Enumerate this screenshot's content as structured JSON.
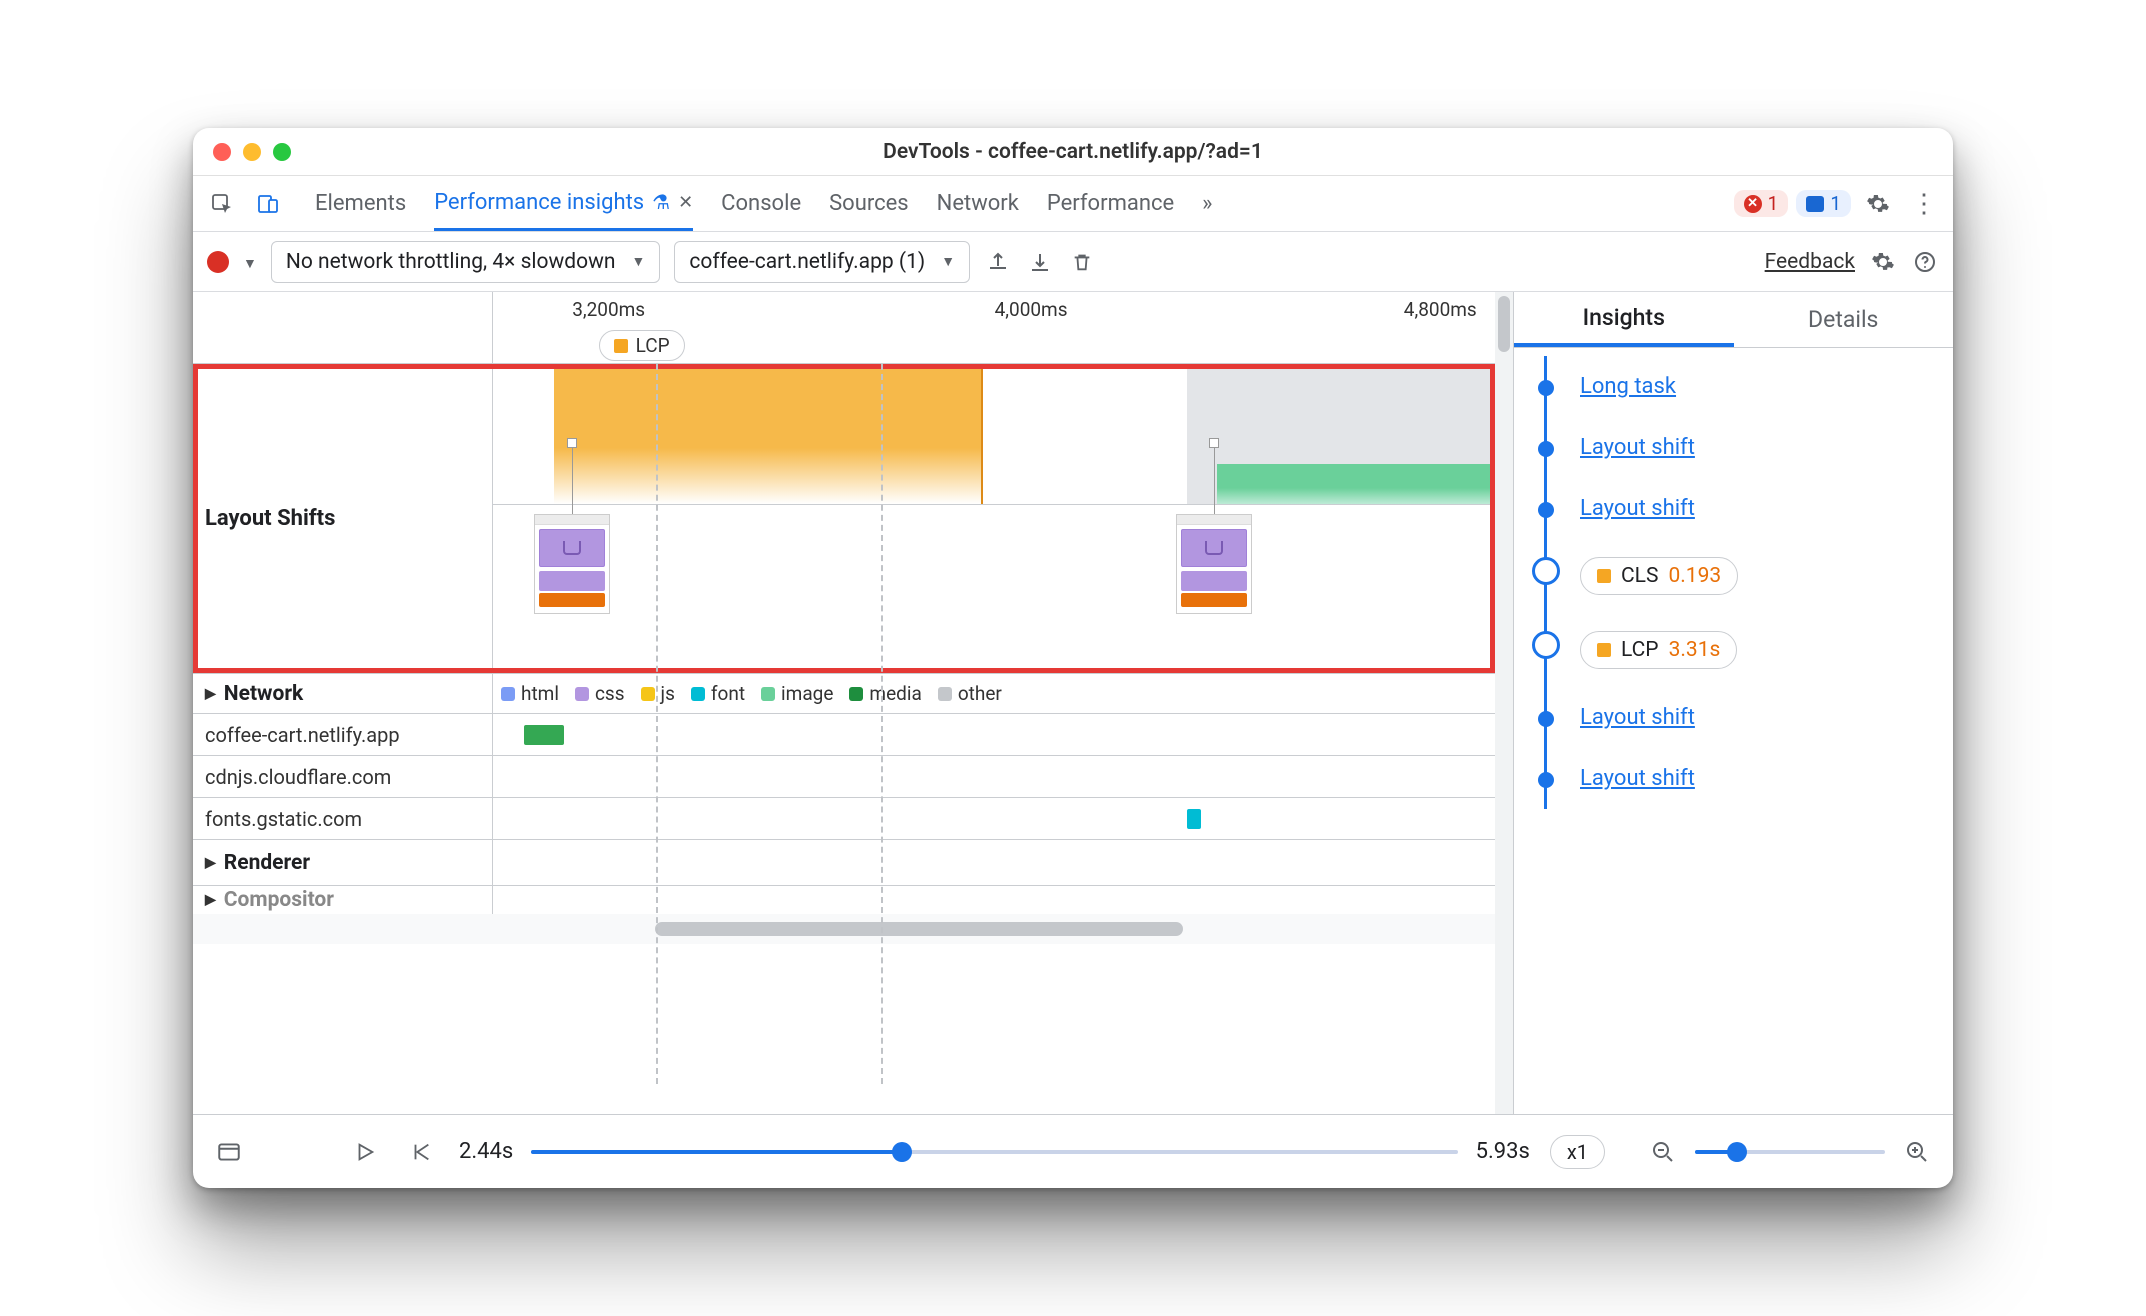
{
  "window": {
    "title": "DevTools - coffee-cart.netlify.app/?ad=1"
  },
  "tabs": {
    "items": [
      "Elements",
      "Performance insights",
      "Console",
      "Sources",
      "Network",
      "Performance"
    ],
    "activeIndex": 1,
    "errors": "1",
    "messages": "1"
  },
  "toolbar": {
    "throttling": "No network throttling, 4× slowdown",
    "recording": "coffee-cart.netlify.app (1)",
    "feedback": "Feedback"
  },
  "timeline": {
    "ticks": [
      {
        "label": "3,200ms",
        "leftPct": 6
      },
      {
        "label": "4,000ms",
        "leftPct": 38
      },
      {
        "label": "4,800ms",
        "leftPct": 69
      }
    ],
    "lcpPill": {
      "label": "LCP",
      "leftPct": 8
    },
    "layoutShiftsLabel": "Layout Shifts",
    "vlines": [
      {
        "leftPct": 16,
        "dashed": true
      },
      {
        "leftPct": 38,
        "dashed": true
      }
    ],
    "orangeBlock": {
      "leftPct": 6,
      "widthPct": 42
    },
    "grayBlock": {
      "leftPct": 68,
      "widthPct": 30
    },
    "greenBlock": {
      "leftPct": 71,
      "widthPct": 27
    },
    "thumbs": [
      {
        "leftPct": 4
      },
      {
        "leftPct": 67
      }
    ],
    "networkLabel": "Network",
    "legend": {
      "html": "html",
      "css": "css",
      "js": "js",
      "font": "font",
      "image": "image",
      "media": "media",
      "other": "other"
    },
    "networkRows": [
      {
        "host": "coffee-cart.netlify.app",
        "bars": [
          {
            "leftPct": 3,
            "widthPct": 4,
            "color": "#34a853"
          }
        ]
      },
      {
        "host": "cdnjs.cloudflare.com",
        "bars": []
      },
      {
        "host": "fonts.gstatic.com",
        "bars": [
          {
            "leftPct": 68,
            "widthPct": 1.4,
            "color": "#00bcd4"
          }
        ]
      }
    ],
    "rendererLabel": "Renderer",
    "compositorLabel": "Compositor"
  },
  "bottom": {
    "start": "2.44s",
    "end": "5.93s",
    "speed": "x1",
    "knobPct": 40,
    "zoomKnobPct": 22
  },
  "sidebar": {
    "tabs": {
      "insights": "Insights",
      "details": "Details"
    },
    "items": [
      {
        "kind": "link",
        "label": "Long task"
      },
      {
        "kind": "link",
        "label": "Layout shift"
      },
      {
        "kind": "link",
        "label": "Layout shift"
      },
      {
        "kind": "metric",
        "name": "CLS",
        "value": "0.193",
        "color": "#f5a623"
      },
      {
        "kind": "metric",
        "name": "LCP",
        "value": "3.31s",
        "color": "#f5a623"
      },
      {
        "kind": "link",
        "label": "Layout shift"
      },
      {
        "kind": "link",
        "label": "Layout shift"
      }
    ]
  },
  "colors": {
    "html": "#7b9cf5",
    "css": "#b296e0",
    "js": "#f5c518",
    "font": "#00bcd4",
    "image": "#6ad09a",
    "media": "#1e8e3e",
    "other": "#c4c7cb"
  }
}
